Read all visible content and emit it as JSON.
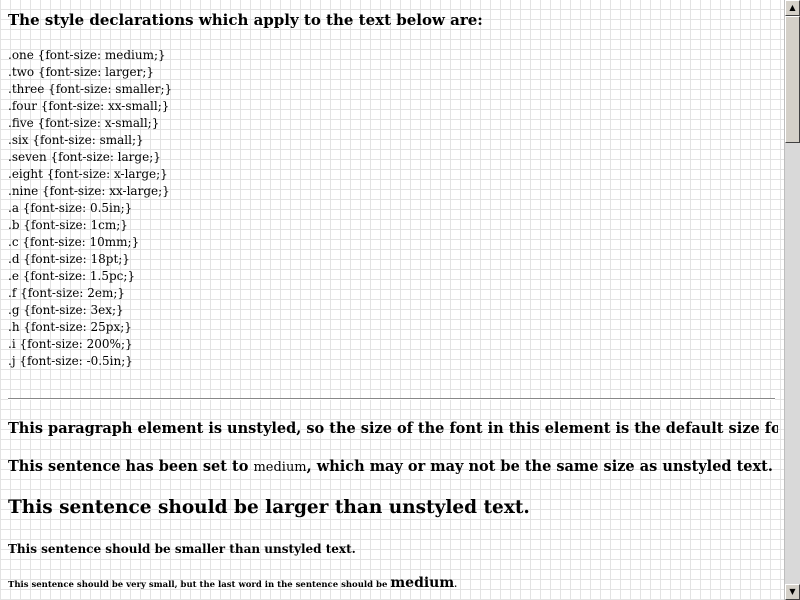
{
  "heading": "The style declarations which apply to the text below are:",
  "style_declarations": ".one {font-size: medium;}\n.two {font-size: larger;}\n.three {font-size: smaller;}\n.four {font-size: xx-small;}\n.five {font-size: x-small;}\n.six {font-size: small;}\n.seven {font-size: large;}\n.eight {font-size: x-large;}\n.nine {font-size: xx-large;}\n.a {font-size: 0.5in;}\n.b {font-size: 1cm;}\n.c {font-size: 10mm;}\n.d {font-size: 18pt;}\n.e {font-size: 1.5pc;}\n.f {font-size: 2em;}\n.g {font-size: 3ex;}\n.h {font-size: 25px;}\n.i {font-size: 200%;}\n.j {font-size: -0.5in;}",
  "paragraphs": {
    "unstyled": "This paragraph element is unstyled, so the size of the font in this element is the default size for this user agent.",
    "medium_pre": "This sentence has been set to ",
    "medium_word": "medium",
    "medium_post": ", which may or may not be the same size as unstyled text.",
    "larger": "This sentence should be larger than unstyled text.",
    "smaller": "This sentence should be smaller than unstyled text.",
    "very_small_pre": "This sentence should be very small, but the last word in the sentence should be ",
    "very_small_last": "medium",
    "very_small_post": "."
  },
  "scrollbar": {
    "up_arrow_icon": "triangle-up",
    "down_arrow_icon": "triangle-down",
    "up_glyph": "▲",
    "down_glyph": "▼"
  }
}
